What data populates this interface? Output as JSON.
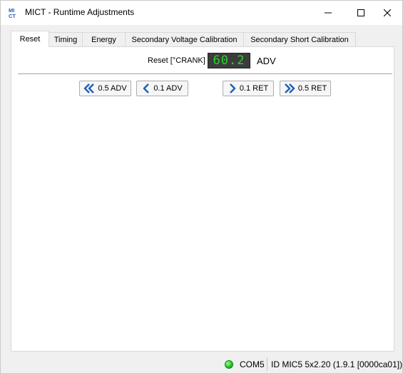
{
  "window": {
    "title": "MICT - Runtime Adjustments",
    "app_icon": "mict-logo-icon"
  },
  "tabs": [
    {
      "label": "Reset",
      "active": true
    },
    {
      "label": "Timing",
      "active": false
    },
    {
      "label": "Energy",
      "active": false
    },
    {
      "label": "Secondary Voltage Calibration",
      "active": false
    },
    {
      "label": "Secondary Short Calibration",
      "active": false
    }
  ],
  "reset_panel": {
    "label": "Reset [°CRANK]",
    "value": "60.2",
    "unit": "ADV",
    "display_color": "#2bd12b",
    "buttons": [
      {
        "label": "0.5 ADV",
        "icon": "double-chevron-left-icon"
      },
      {
        "label": "0.1 ADV",
        "icon": "chevron-left-icon"
      },
      {
        "label": "0.1 RET",
        "icon": "chevron-right-icon"
      },
      {
        "label": "0.5 RET",
        "icon": "double-chevron-right-icon"
      }
    ],
    "icon_color": "#1f5fb4"
  },
  "status": {
    "connected": true,
    "led_color": "#1fbf1f",
    "port": "COM5",
    "device_id": "ID MIC5 5x2.20 (1.9.1 [0000ca01])"
  }
}
